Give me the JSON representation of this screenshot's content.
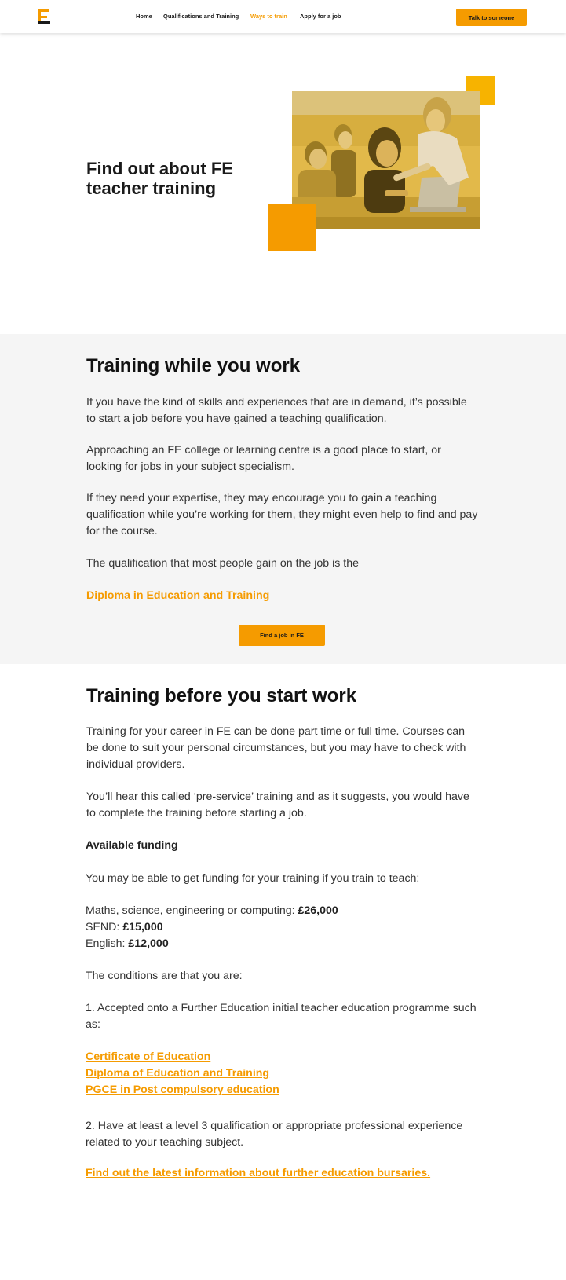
{
  "nav": {
    "logo_alt": "E",
    "links": [
      "Home",
      "Qualifications and Training",
      "Ways to train",
      "Apply for a job"
    ],
    "active": "Ways to train",
    "cta": "Talk to someone"
  },
  "hero": {
    "title": "Find out about FE teacher training"
  },
  "work": {
    "heading": "Training while you work",
    "p1": "If you have the kind of skills and experiences that are in demand, it’s possible to start a job before you have gained a teaching qualification.",
    "p2": "Approaching an FE college or learning centre is a good place to start, or looking for jobs in your subject specialism.",
    "p3": "If they need your expertise, they may encourage you to gain a teaching qualification while you’re working for them, they might even help to find and pay for the course.",
    "p4": "The qualification that most people gain on the job is the",
    "link": "Diploma in Education and Training",
    "button": "Find a job in FE"
  },
  "before": {
    "heading": "Training before you start work",
    "p1": "Training for your career in FE can be done part time or full time. Courses can be done to suit your personal circumstances, but you may have to check with individual providers.",
    "p2": "You’ll hear this called ‘pre-service’ training and as it suggests, you would have to complete the training before starting a job.",
    "funding_heading": "Available funding",
    "funding_intro": "You may be able to get funding for your training if you train to teach:",
    "funding": [
      {
        "subject": "Maths, science, engineering or computing: ",
        "amount": "£26,000"
      },
      {
        "subject": "SEND: ",
        "amount": "£15,000"
      },
      {
        "subject": "English: ",
        "amount": "£12,000"
      }
    ],
    "conditions": "The conditions are that you are:",
    "cond1": "1. Accepted onto a Further Education initial teacher education programme such as:",
    "courses": [
      "Certificate of Education",
      "Diploma of Education and Training",
      "PGCE in Post compulsory education"
    ],
    "cond2": "2. Have at least a level 3 qualification or appropriate professional experience related to your teaching subject.",
    "bursary_link": "Find out the latest information about further education bursaries."
  },
  "colors": {
    "accent": "#f59b00",
    "grey_bg": "#f5f5f5"
  }
}
